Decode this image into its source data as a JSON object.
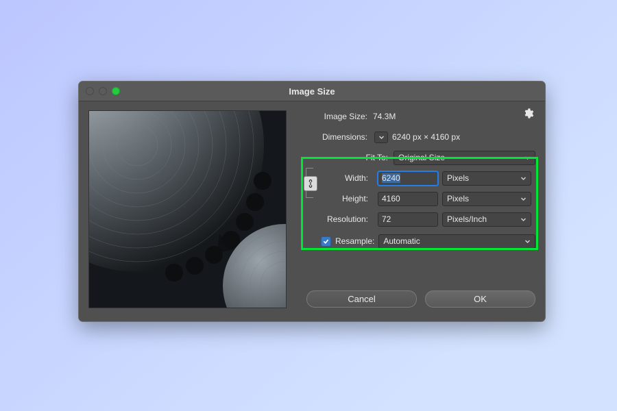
{
  "title": "Image Size",
  "info": {
    "imgsize_label": "Image Size:",
    "imgsize_value": "74.3M",
    "dimensions_label": "Dimensions:",
    "dimensions_value": "6240 px  ×  4160 px",
    "fitto_label": "Fit To:",
    "fitto_value": "Original Size"
  },
  "fields": {
    "width_label": "Width:",
    "width_value": "6240",
    "width_unit": "Pixels",
    "height_label": "Height:",
    "height_value": "4160",
    "height_unit": "Pixels",
    "resolution_label": "Resolution:",
    "resolution_value": "72",
    "resolution_unit": "Pixels/Inch",
    "resample_label": "Resample:",
    "resample_value": "Automatic"
  },
  "buttons": {
    "cancel": "Cancel",
    "ok": "OK"
  },
  "colors": {
    "highlight": "#00e636",
    "focus_ring": "#237fe7"
  }
}
